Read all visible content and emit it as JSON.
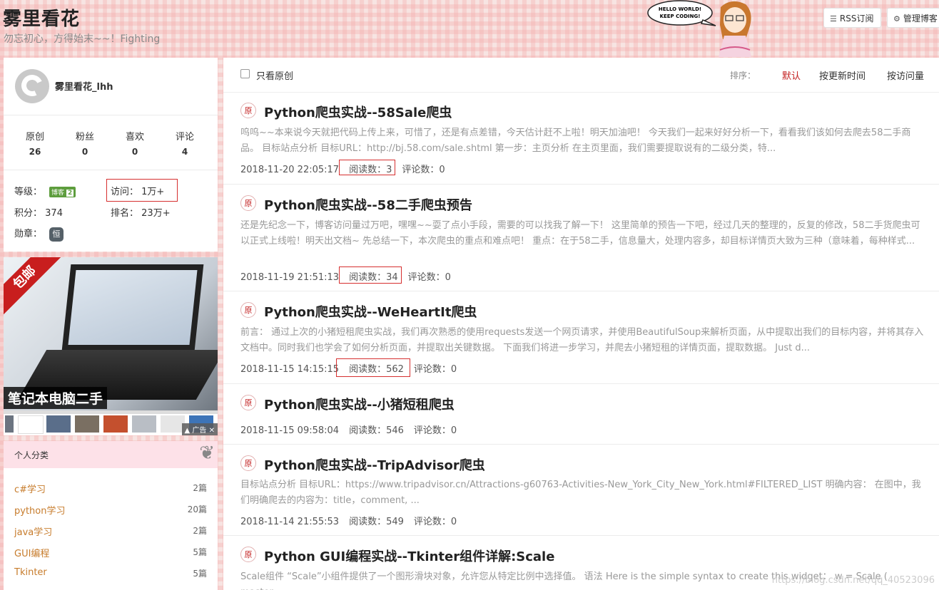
{
  "header": {
    "title": "雾里看花",
    "subtitle": "勿忘初心，方得始末~~！Fighting",
    "mascot_text_1": "HELLO WORLD!",
    "mascot_text_2": "KEEP CODING!",
    "rss_label": "RSS订阅",
    "admin_label": "管理博客"
  },
  "profile": {
    "username": "雾里看花_lhh",
    "stats": [
      {
        "label": "原创",
        "value": "26"
      },
      {
        "label": "粉丝",
        "value": "0"
      },
      {
        "label": "喜欢",
        "value": "0"
      },
      {
        "label": "评论",
        "value": "4"
      }
    ],
    "level_label": "等级：",
    "level_badge": "博客",
    "level_num": "2",
    "visits_label": "访问：",
    "visits_value": "1万+",
    "points_label": "积分：",
    "points_value": "374",
    "rank_label": "排名：",
    "rank_value": "23万+",
    "medal_label": "勋章：",
    "medal_char": "恒"
  },
  "ad": {
    "ribbon": "包邮",
    "caption": "笔记本电脑二手",
    "tag": "广告"
  },
  "categories": {
    "title": "个人分类",
    "items": [
      {
        "name": "c#学习",
        "count": "2篇"
      },
      {
        "name": "python学习",
        "count": "20篇"
      },
      {
        "name": "java学习",
        "count": "2篇"
      },
      {
        "name": "GUI编程",
        "count": "5篇"
      },
      {
        "name": "Tkinter",
        "count": "5篇"
      }
    ]
  },
  "toolbar": {
    "only_original": "只看原创",
    "sort_label": "排序：",
    "sort_default": "默认",
    "sort_update": "按更新时间",
    "sort_visits": "按访问量"
  },
  "posts": [
    {
      "badge": "原",
      "title": "Python爬虫实战--58Sale爬虫",
      "summary": "呜呜~~本来说今天就把代码上传上来，可惜了，还是有点差错，今天估计赶不上啦！明天加油吧！ 今天我们一起来好好分析一下，看看我们该如何去爬去58二手商品。 目标站点分析 目标URL：http://bj.58.com/sale.shtml 第一步：主页分析 在主页里面，我们需要提取说有的二级分类，特...",
      "date": "2018-11-20 22:05:17",
      "reads": "阅读数：3",
      "comments": "评论数：0"
    },
    {
      "badge": "原",
      "title": "Python爬虫实战--58二手爬虫预告",
      "summary": "还是先纪念一下，博客访问量过万吧，嘿嘿~~耍了点小手段，需要的可以找我了解一下！ 这里简单的预告一下吧，经过几天的整理的，反复的修改，58二手货爬虫可以正式上线啦！明天出文档~ 先总结一下，本次爬虫的重点和难点吧！ 重点：在于58二手，信息量大，处理内容多，却目标详情页大致为三种（意味着，每种样式...",
      "date": "2018-11-19 21:51:13",
      "reads": "阅读数：34",
      "comments": "评论数：0"
    },
    {
      "badge": "原",
      "title": "Python爬虫实战--WeHeartIt爬虫",
      "summary": "前言： 通过上次的小猪短租爬虫实战，我们再次熟悉的使用requests发送一个网页请求，并使用BeautifulSoup来解析页面，从中提取出我们的目标内容，并将其存入文档中。同时我们也学会了如何分析页面，并提取出关键数据。 下面我们将进一步学习，并爬去小猪短租的详情页面，提取数据。 Just d...",
      "date": "2018-11-15 14:15:15",
      "reads": "阅读数：562",
      "comments": "评论数：0"
    },
    {
      "badge": "原",
      "title": "Python爬虫实战--小猪短租爬虫",
      "summary": "",
      "date": "2018-11-15 09:58:04",
      "reads": "阅读数：546",
      "comments": "评论数：0"
    },
    {
      "badge": "原",
      "title": "Python爬虫实战--TripAdvisor爬虫",
      "summary": "目标站点分析 目标URL：https://www.tripadvisor.cn/Attractions-g60763-Activities-New_York_City_New_York.html#FILTERED_LIST 明确内容： 在图中，我们明确爬去的内容为：title，comment, ...",
      "date": "2018-11-14 21:55:53",
      "reads": "阅读数：549",
      "comments": "评论数：0"
    },
    {
      "badge": "原",
      "title": "Python GUI编程实战--Tkinter组件详解:Scale",
      "summary": "Scale组件 “Scale”小组件提供了一个图形滑块对象，允许您从特定比例中选择值。 语法 Here is the simple syntax to create this widget： w = Scale ( master, ...",
      "date": "",
      "reads": "",
      "comments": ""
    }
  ],
  "watermark": "https://blog.csdn.net/qq_40523096"
}
